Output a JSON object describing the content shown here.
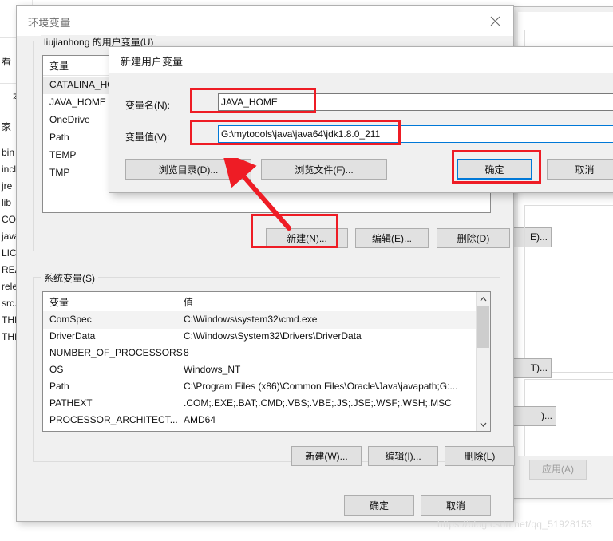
{
  "background": {
    "explorer": {
      "glyphs": [
        "看",
        "本",
        "家"
      ],
      "files": [
        "bin",
        "incl",
        "jre",
        "lib",
        "COI",
        "java",
        "LICI",
        "REA",
        "rele",
        "src.",
        "THI",
        "THI"
      ]
    },
    "right_window": {
      "buttons": [
        "E)...",
        "T)...",
        ")..."
      ],
      "apply_label": "应用(A)"
    }
  },
  "env_dialog": {
    "title": "环境变量",
    "close_icon": "close-icon",
    "user_group": {
      "label": "liujianhong 的用户变量(U)",
      "columns": [
        "变量",
        "值"
      ],
      "rows": [
        {
          "name": "CATALINA_HOME",
          "value": ""
        },
        {
          "name": "JAVA_HOME",
          "value": ""
        },
        {
          "name": "OneDrive",
          "value": ""
        },
        {
          "name": "Path",
          "value": ""
        },
        {
          "name": "TEMP",
          "value": ""
        },
        {
          "name": "TMP",
          "value": ""
        }
      ],
      "buttons": {
        "new": "新建(N)...",
        "edit": "编辑(E)...",
        "delete": "删除(D)"
      }
    },
    "system_group": {
      "label": "系统变量(S)",
      "columns": [
        "变量",
        "值"
      ],
      "rows": [
        {
          "name": "ComSpec",
          "value": "C:\\Windows\\system32\\cmd.exe"
        },
        {
          "name": "DriverData",
          "value": "C:\\Windows\\System32\\Drivers\\DriverData"
        },
        {
          "name": "NUMBER_OF_PROCESSORS",
          "value": "8"
        },
        {
          "name": "OS",
          "value": "Windows_NT"
        },
        {
          "name": "Path",
          "value": "C:\\Program Files (x86)\\Common Files\\Oracle\\Java\\javapath;G:..."
        },
        {
          "name": "PATHEXT",
          "value": ".COM;.EXE;.BAT;.CMD;.VBS;.VBE;.JS;.JSE;.WSF;.WSH;.MSC"
        },
        {
          "name": "PROCESSOR_ARCHITECT...",
          "value": "AMD64"
        }
      ],
      "buttons": {
        "new": "新建(W)...",
        "edit": "编辑(I)...",
        "delete": "删除(L)"
      }
    },
    "footer": {
      "ok": "确定",
      "cancel": "取消"
    }
  },
  "newvar_dialog": {
    "title": "新建用户变量",
    "name_label": "变量名(N):",
    "name_value": "JAVA_HOME",
    "value_label": "变量值(V):",
    "value_value": "G:\\mytoools\\java\\java64\\jdk1.8.0_211",
    "browse_dir": "浏览目录(D)...",
    "browse_file": "浏览文件(F)...",
    "ok": "确定",
    "cancel": "取消"
  },
  "annotations": {
    "accent_red": "#ee1c25",
    "accent_blue": "#0078d7"
  },
  "watermark": "https://blog.csdn.net/qq_51928153"
}
